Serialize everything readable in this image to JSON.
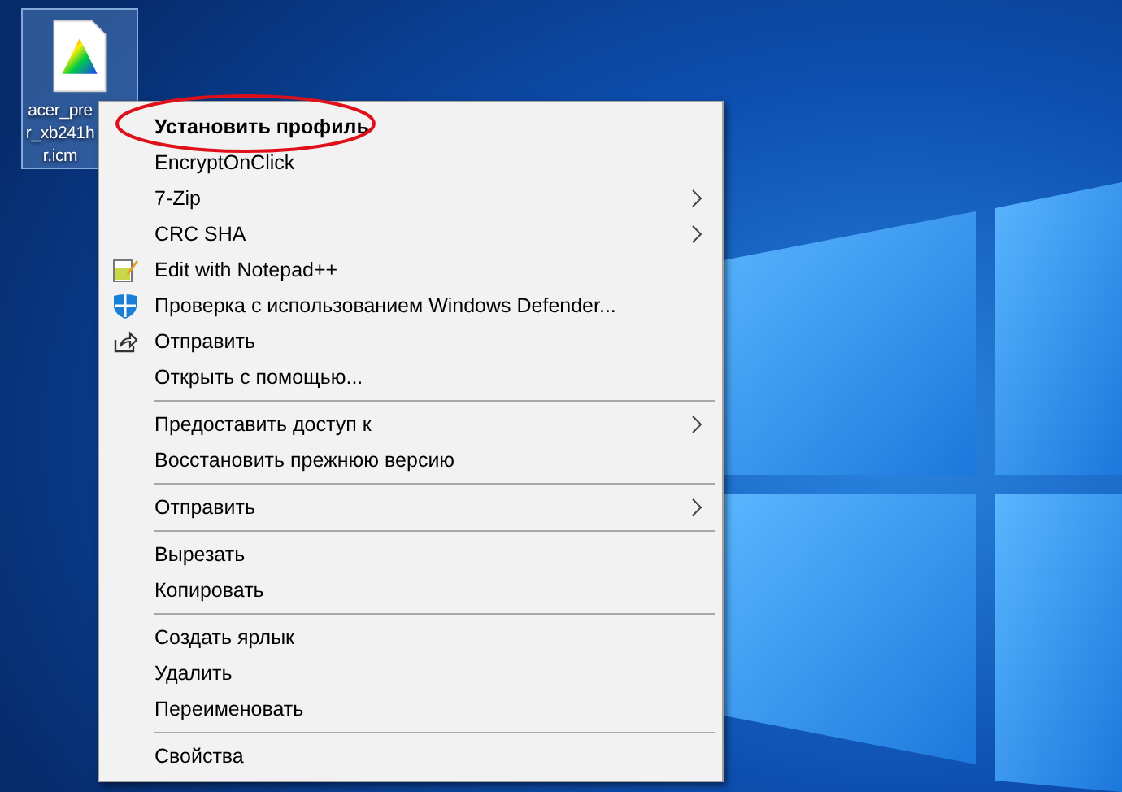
{
  "desktop_icon": {
    "label_lines": [
      "acer_pre",
      "r_xb241h",
      "r.icm"
    ],
    "selected": true
  },
  "context_menu": {
    "groups": [
      {
        "items": [
          {
            "label": "Установить профиль",
            "kind": "plain",
            "default": true,
            "submenu": false
          },
          {
            "label": "EncryptOnClick",
            "kind": "plain",
            "default": false,
            "submenu": false
          },
          {
            "label": "7-Zip",
            "kind": "plain",
            "default": false,
            "submenu": true
          },
          {
            "label": "CRC SHA",
            "kind": "plain",
            "default": false,
            "submenu": true
          },
          {
            "label": "Edit with Notepad++",
            "kind": "notepad",
            "default": false,
            "submenu": false
          },
          {
            "label": "Проверка с использованием Windows Defender...",
            "kind": "defender",
            "default": false,
            "submenu": false
          },
          {
            "label": "Отправить",
            "kind": "share",
            "default": false,
            "submenu": false
          },
          {
            "label": "Открыть с помощью...",
            "kind": "plain",
            "default": false,
            "submenu": false
          }
        ]
      },
      {
        "items": [
          {
            "label": "Предоставить доступ к",
            "kind": "plain",
            "default": false,
            "submenu": true
          },
          {
            "label": "Восстановить прежнюю версию",
            "kind": "plain",
            "default": false,
            "submenu": false
          }
        ]
      },
      {
        "items": [
          {
            "label": "Отправить",
            "kind": "plain",
            "default": false,
            "submenu": true
          }
        ]
      },
      {
        "items": [
          {
            "label": "Вырезать",
            "kind": "plain",
            "default": false,
            "submenu": false
          },
          {
            "label": "Копировать",
            "kind": "plain",
            "default": false,
            "submenu": false
          }
        ]
      },
      {
        "items": [
          {
            "label": "Создать ярлык",
            "kind": "plain",
            "default": false,
            "submenu": false
          },
          {
            "label": "Удалить",
            "kind": "plain",
            "default": false,
            "submenu": false
          },
          {
            "label": "Переименовать",
            "kind": "plain",
            "default": false,
            "submenu": false
          }
        ]
      },
      {
        "items": [
          {
            "label": "Свойства",
            "kind": "plain",
            "default": false,
            "submenu": false
          }
        ]
      }
    ]
  }
}
